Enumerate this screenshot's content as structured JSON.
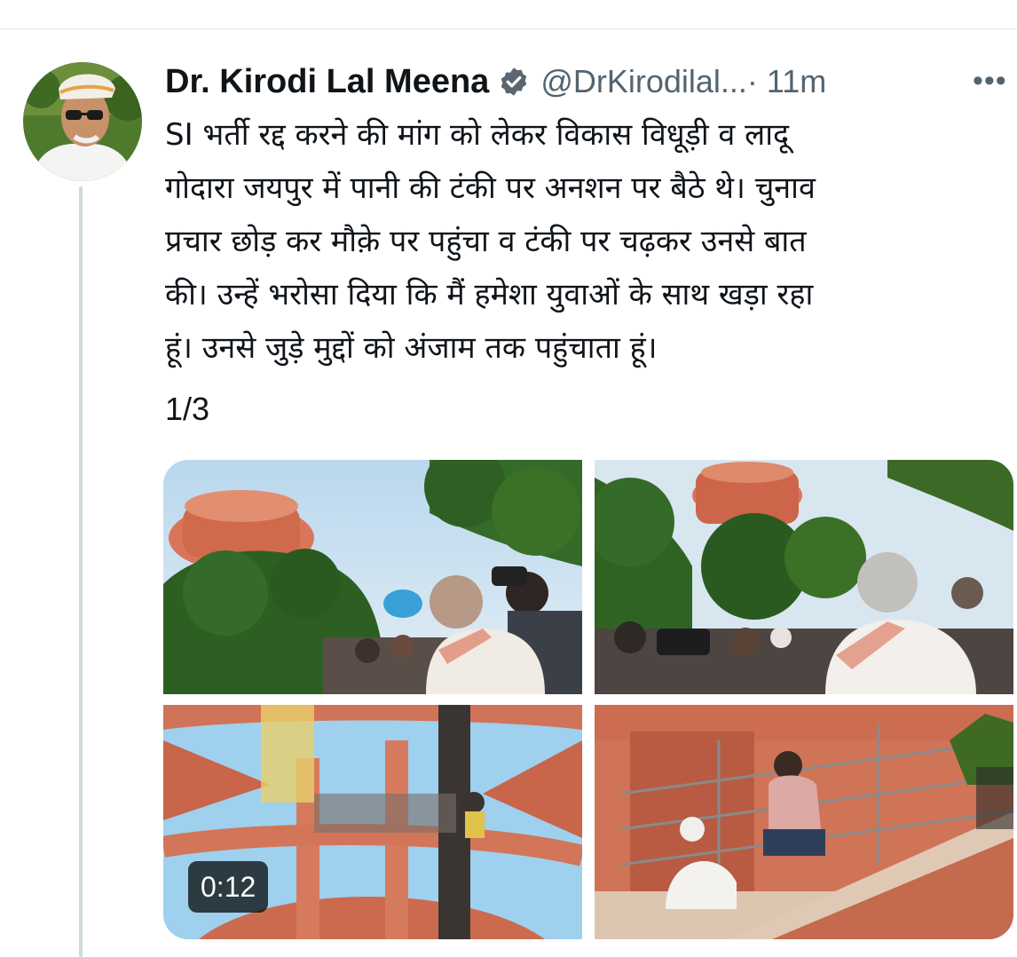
{
  "tweet": {
    "author_name": "Dr. Kirodi Lal Meena",
    "handle": "@DrKirodilal...",
    "timestamp": "· 11m",
    "more_label": "•••",
    "text": "SI भर्ती रद्द करने की मांग को लेकर विकास विधूड़ी व लादू\nगोदारा जयपुर में पानी की टंकी पर अनशन पर बैठे थे। चुनाव\nप्रचार छोड़ कर मौक़े पर पहुंचा व टंकी पर चढ़कर उनसे बात\nकी। उन्हें भरोसा दिया कि मैं हमेशा युवाओं के साथ खड़ा रहा\nहूं। उनसे जुड़े मुद्दों को अंजाम तक पहुंचाता हूं।",
    "thread_counter": "1/3",
    "verified_color": "#5b6670",
    "media": {
      "video_duration": "0:12",
      "items": [
        {
          "type": "video",
          "scene": "water tank with crowd and megaphone"
        },
        {
          "type": "image",
          "scene": "water tank, crowd and cameramen"
        },
        {
          "type": "image",
          "scene": "looking up inside tank stairway"
        },
        {
          "type": "image",
          "scene": "men sitting on tank stairway"
        }
      ]
    }
  }
}
